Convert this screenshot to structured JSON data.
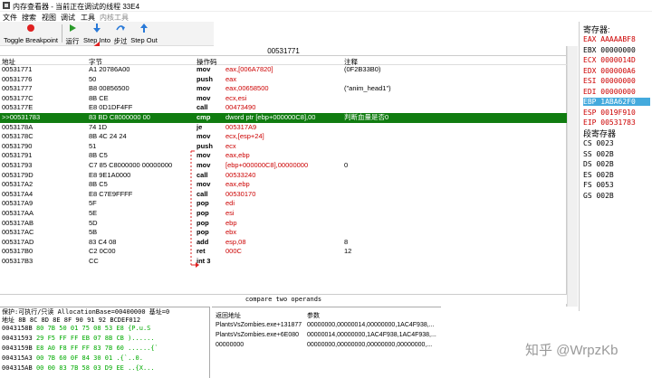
{
  "window": {
    "title": "内存查看器 - 当前正在调试的线程 33E4"
  },
  "menu": [
    "文件",
    "搜索",
    "视图",
    "调试",
    "工具",
    "内核工具"
  ],
  "toolbar": {
    "toggle_bp": "Toggle Breakpoint",
    "run": "运行",
    "step_into": "Step Into",
    "step_over": "步过",
    "step_out": "Step Out",
    "colors": {
      "run": "#2a9a2a",
      "step": "#2a7ad8",
      "bp": "#e02020"
    }
  },
  "disasm": {
    "address_header": "00531771",
    "columns": [
      "地址",
      "字节",
      "操作码",
      "注释"
    ],
    "rows": [
      {
        "addr": "00531771",
        "bytes": "A1 20786A00",
        "op": "mov",
        "args": "eax,[006A7820]",
        "comment": "(0F2B33B0)"
      },
      {
        "addr": "00531776",
        "bytes": "50",
        "op": "push",
        "args": "eax",
        "comment": ""
      },
      {
        "addr": "00531777",
        "bytes": "B8 00856500",
        "op": "mov",
        "args": "eax,00658500",
        "comment": "(\"anim_head1\")"
      },
      {
        "addr": "0053177C",
        "bytes": "8B CE",
        "op": "mov",
        "args": "ecx,esi",
        "comment": ""
      },
      {
        "addr": "0053177E",
        "bytes": "E8 0D1DF4FF",
        "op": "call",
        "args": "00473490",
        "comment": ""
      },
      {
        "addr": ">>00531783",
        "bytes": "83 BD C8000000 00",
        "op": "cmp",
        "args": "dword ptr [ebp+000000C8],00",
        "comment": "判断血量是否0",
        "selected": true
      },
      {
        "addr": "0053178A",
        "bytes": "74 1D",
        "op": "je",
        "args": "005317A9",
        "comment": ""
      },
      {
        "addr": "0053178C",
        "bytes": "8B 4C 24 24",
        "op": "mov",
        "args": "ecx,[esp+24]",
        "comment": ""
      },
      {
        "addr": "00531790",
        "bytes": "51",
        "op": "push",
        "args": "ecx",
        "comment": ""
      },
      {
        "addr": "00531791",
        "bytes": "8B C5",
        "op": "mov",
        "args": "eax,ebp",
        "comment": ""
      },
      {
        "addr": "00531793",
        "bytes": "C7 85 C8000000 00000000",
        "op": "mov",
        "args": "[ebp+000000C8],00000000",
        "comment": "0"
      },
      {
        "addr": "0053179D",
        "bytes": "E8 9E1A0000",
        "op": "call",
        "args": "00533240",
        "comment": ""
      },
      {
        "addr": "005317A2",
        "bytes": "8B C5",
        "op": "mov",
        "args": "eax,ebp",
        "comment": ""
      },
      {
        "addr": "005317A4",
        "bytes": "E8 C7E9FFFF",
        "op": "call",
        "args": "00530170",
        "comment": ""
      },
      {
        "addr": "005317A9",
        "bytes": "5F",
        "op": "pop",
        "args": "edi",
        "comment": ""
      },
      {
        "addr": "005317AA",
        "bytes": "5E",
        "op": "pop",
        "args": "esi",
        "comment": ""
      },
      {
        "addr": "005317AB",
        "bytes": "5D",
        "op": "pop",
        "args": "ebp",
        "comment": ""
      },
      {
        "addr": "005317AC",
        "bytes": "5B",
        "op": "pop",
        "args": "ebx",
        "comment": ""
      },
      {
        "addr": "005317AD",
        "bytes": "83 C4 08",
        "op": "add",
        "args": "esp,08",
        "comment": "8"
      },
      {
        "addr": "005317B0",
        "bytes": "C2 0C00",
        "op": "ret",
        "args": "000C",
        "comment": "12"
      },
      {
        "addr": "005317B3",
        "bytes": "CC",
        "op": "int 3",
        "args": "",
        "comment": ""
      }
    ],
    "status": "compare two operands"
  },
  "registers": {
    "title": "寄存器:",
    "items": [
      {
        "name": "EAX",
        "value": "AAAAABF8",
        "red": true
      },
      {
        "name": "EBX",
        "value": "00000000",
        "red": false
      },
      {
        "name": "ECX",
        "value": "0000014D",
        "red": true
      },
      {
        "name": "EDX",
        "value": "000000A6",
        "red": true
      },
      {
        "name": "ESI",
        "value": "00000000",
        "red": true
      },
      {
        "name": "EDI",
        "value": "00000000",
        "red": true
      },
      {
        "name": "EBP",
        "value": "1ABA62F0",
        "red": false,
        "highlight": true
      },
      {
        "name": "ESP",
        "value": "0019F910",
        "red": true
      },
      {
        "name": "EIP",
        "value": "00531783",
        "red": true
      }
    ],
    "seg_title": "段寄存器",
    "segs": [
      {
        "name": "CS",
        "value": "0023"
      },
      {
        "name": "SS",
        "value": "002B"
      },
      {
        "name": "DS",
        "value": "002B"
      },
      {
        "name": "ES",
        "value": "002B"
      },
      {
        "name": "FS",
        "value": "0053"
      },
      {
        "name": "GS",
        "value": "002B"
      }
    ]
  },
  "hexview": {
    "header": "保护:可执行/只读  AllocationBase=00400000  基址=0",
    "cols": "地址     8B 8C 8D 8E 8F 90 91 92 BCDEF012",
    "rows": [
      {
        "addr": "0043158B",
        "bytes": "80 7B 50 01 75 08 53 E8",
        "ascii": "{P.u.S"
      },
      {
        "addr": "00431593",
        "bytes": "29 F5 FF FF EB 07 8B CB",
        "ascii": ")......"
      },
      {
        "addr": "0043159B",
        "bytes": "E8 A0 F8 FF FF 83 7B 60",
        "ascii": "......{`"
      },
      {
        "addr": "004315A3",
        "bytes": "00 7B 60 0F 84 30 01",
        "ascii": ".{`..0."
      },
      {
        "addr": "004315AB",
        "bytes": "00 00 83 7B 58 03 D9 EE",
        "ascii": "..{X..."
      }
    ]
  },
  "stack": {
    "columns": [
      "返回地址",
      "参数"
    ],
    "rows": [
      {
        "ret": "PlantsVsZombies.exe+131877",
        "args": "00000000,00000014,00000000,1AC4F938,..."
      },
      {
        "ret": "PlantsVsZombies.exe+6E080",
        "args": "00000014,00000000,1AC4F938,1AC4F938,..."
      },
      {
        "ret": "00000000",
        "args": "00000000,00000000,00000000,00000000,..."
      }
    ]
  },
  "watermark": "知乎 @WrpzKb"
}
